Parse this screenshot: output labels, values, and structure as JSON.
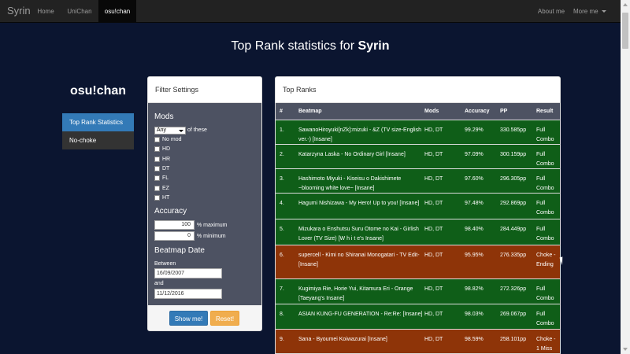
{
  "navbar": {
    "brand": "Syrin",
    "items": [
      "Home",
      "UniChan",
      "osu!chan"
    ],
    "right": [
      "About me",
      "More me"
    ]
  },
  "page": {
    "title_prefix": "Top Rank statistics for ",
    "title_user": "Syrin"
  },
  "sidebar": {
    "title": "osu!chan",
    "items": [
      "Top Rank Statistics",
      "No-choke"
    ]
  },
  "filter": {
    "header": "Filter Settings",
    "mods_label": "Mods",
    "mods_select": "Any",
    "mods_suffix": "of these",
    "mods_options": [
      "No mod",
      "HD",
      "HR",
      "DT",
      "FL",
      "EZ",
      "HT"
    ],
    "accuracy_label": "Accuracy",
    "acc_max": "100",
    "acc_max_label": "% maximum",
    "acc_min": "0",
    "acc_min_label": "% minimum",
    "date_label": "Beatmap Date",
    "between_label": "Between",
    "date_from": "16/09/2007",
    "and_label": "and",
    "date_to": "11/12/2016",
    "show_button": "Show me!",
    "reset_button": "Reset!"
  },
  "ranks": {
    "header": "Top Ranks",
    "columns": [
      "#",
      "Beatmap",
      "Mods",
      "Accuracy",
      "PP",
      "Result"
    ],
    "rows": [
      {
        "no": "1.",
        "beatmap": "SawanoHiroyuki[nZk]:mizuki - &Z (TV size-English ver.-) [Insane]",
        "mods": "HD, DT",
        "accuracy": "99.29%",
        "pp": "330.585pp",
        "result": "Full Combo",
        "status": "fc"
      },
      {
        "no": "2.",
        "beatmap": "Katarzyna Laska - No Ordinary Girl [Insane]",
        "mods": "HD, DT",
        "accuracy": "97.09%",
        "pp": "300.159pp",
        "result": "Full Combo",
        "status": "fc"
      },
      {
        "no": "3.",
        "beatmap": "Hashimoto Miyuki - Kiseisu o Dakishimete ~blooming white love~ [Insane]",
        "mods": "HD, DT",
        "accuracy": "97.60%",
        "pp": "296.305pp",
        "result": "Full Combo",
        "status": "fc"
      },
      {
        "no": "4.",
        "beatmap": "Hagumi Nishizawa - My Hero! Up to you! [Insane]",
        "mods": "HD, DT",
        "accuracy": "97.48%",
        "pp": "292.869pp",
        "result": "Full Combo",
        "status": "fc"
      },
      {
        "no": "5.",
        "beatmap": "Mizukara o Enshutsu Suru Otome no Kai - Girlish Lover (TV Size) [W h i t e's Insane]",
        "mods": "HD, DT",
        "accuracy": "98.40%",
        "pp": "284.449pp",
        "result": "Full Combo",
        "status": "fc"
      },
      {
        "no": "6.",
        "beatmap": "supercell - Kimi no Shiranai Monogatari - TV Edit- [Insane]",
        "mods": "HD, DT",
        "accuracy": "95.95%",
        "pp": "276.335pp",
        "result": "Choke - Ending",
        "status": "ch"
      },
      {
        "no": "7.",
        "beatmap": "Kugimiya Rie, Horie Yui, Kitamura Eri - Orange [Taeyang's Insane]",
        "mods": "HD, DT",
        "accuracy": "98.82%",
        "pp": "272.326pp",
        "result": "Full Combo",
        "status": "fc"
      },
      {
        "no": "8.",
        "beatmap": "ASIAN KUNG-FU GENERATION - Re:Re: [Insane]",
        "mods": "HD, DT",
        "accuracy": "98.03%",
        "pp": "269.067pp",
        "result": "Full Combo",
        "status": "fc"
      },
      {
        "no": "9.",
        "beatmap": "Sana - Byoumei Koiwazurai [Insane]",
        "mods": "HD, DT",
        "accuracy": "98.59%",
        "pp": "258.101pp",
        "result": "Choke - 1 Miss",
        "status": "ch"
      }
    ]
  },
  "colors": {
    "background": "#0b1530",
    "full_combo": "#0f5e18",
    "choke": "#8e3408",
    "primary": "#337ab7",
    "warning": "#f0ad4e"
  }
}
